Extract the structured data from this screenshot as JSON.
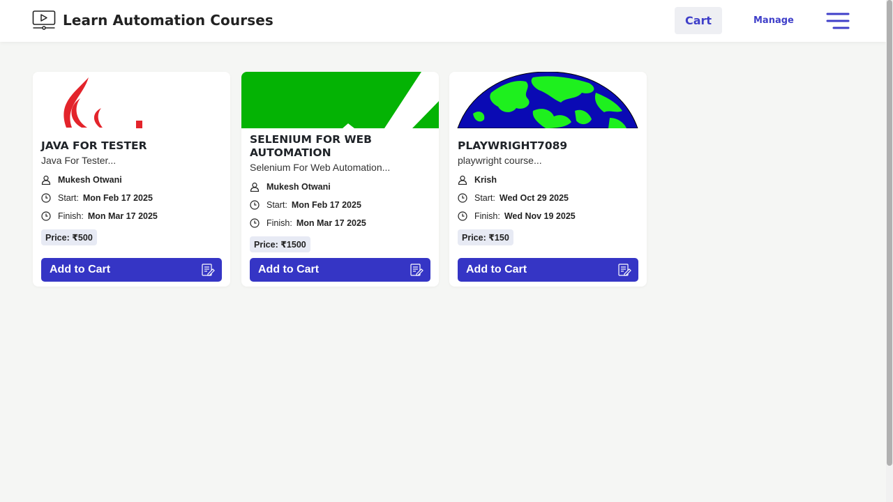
{
  "header": {
    "title": "Learn Automation Courses",
    "cart_label": "Cart",
    "manage_label": "Manage",
    "brand_icon": "video-screen-icon",
    "menu_icon": "hamburger-menu-icon"
  },
  "colors": {
    "accent": "#3535c5",
    "header_link": "#3f3fc9",
    "background": "#f5f6f4"
  },
  "courses": [
    {
      "title": "JAVA FOR TESTER",
      "subtitle": "Java For Tester...",
      "author": "Mukesh Otwani",
      "start_label": "Start:",
      "start": "Mon Feb 17 2025",
      "finish_label": "Finish:",
      "finish": "Mon Mar 17 2025",
      "price": "Price: ₹500",
      "button": "Add to Cart"
    },
    {
      "title": "SELENIUM FOR WEB AUTOMATION",
      "subtitle": "Selenium For Web Automation...",
      "author": "Mukesh Otwani",
      "start_label": "Start:",
      "start": "Mon Feb 17 2025",
      "finish_label": "Finish:",
      "finish": "Mon Mar 17 2025",
      "price": "Price: ₹1500",
      "button": "Add to Cart"
    },
    {
      "title": "PLAYWRIGHT7089",
      "subtitle": "playwright course...",
      "author": "Krish",
      "start_label": "Start:",
      "start": "Wed Oct 29 2025",
      "finish_label": "Finish:",
      "finish": "Wed Nov 19 2025",
      "price": "Price: ₹150",
      "button": "Add to Cart"
    }
  ]
}
